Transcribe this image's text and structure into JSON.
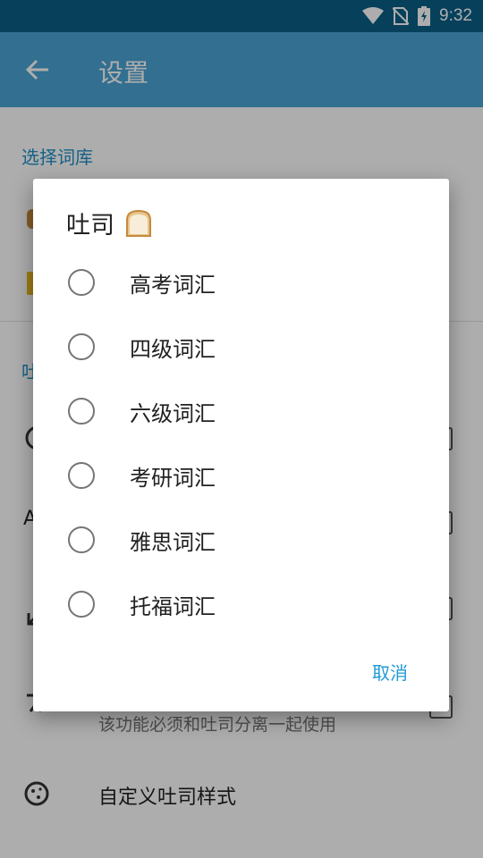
{
  "status_bar": {
    "time": "9:32"
  },
  "app_bar": {
    "title": "设置"
  },
  "settings": {
    "section_vocab": "选择词库",
    "section_toast_partial": "吐",
    "row_a_partial": "A",
    "row_custom_desc": "该功能必须和吐司分离一起使用",
    "row_custom_style": "自定义吐司样式"
  },
  "dialog": {
    "title": "吐司",
    "options": [
      {
        "label": "高考词汇"
      },
      {
        "label": "四级词汇"
      },
      {
        "label": "六级词汇"
      },
      {
        "label": "考研词汇"
      },
      {
        "label": "雅思词汇"
      },
      {
        "label": "托福词汇"
      }
    ],
    "cancel_label": "取消"
  },
  "colors": {
    "status_bar": "#0a5f87",
    "app_bar": "#4aa4d4",
    "accent": "#1f8fc7"
  }
}
